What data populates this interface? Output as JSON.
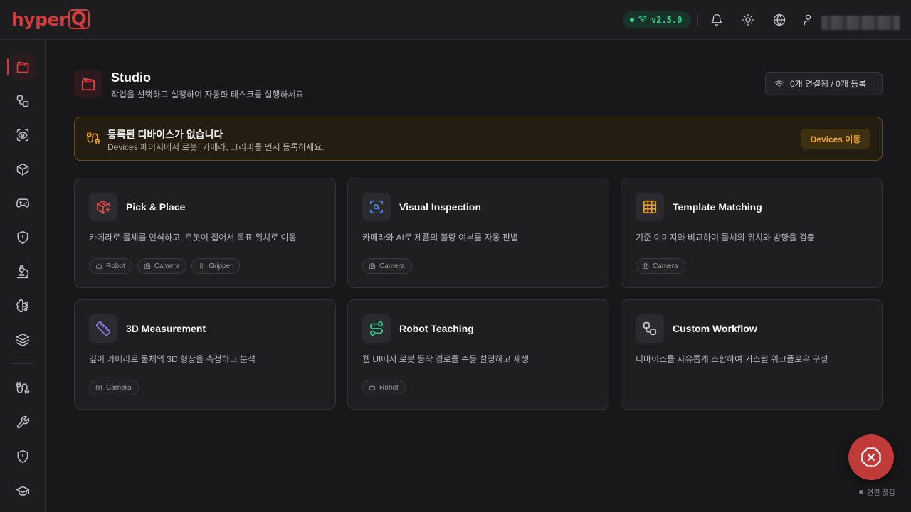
{
  "brand": {
    "name": "hyper",
    "suffix": "Q",
    "color": "#d63a3a"
  },
  "topbar": {
    "version": "v2.5.0",
    "icons": [
      "wifi-icon",
      "bell-icon",
      "sun-icon",
      "globe-icon",
      "user-icon"
    ]
  },
  "sidebar": {
    "items": [
      {
        "name": "studio",
        "icon": "clapperboard-icon",
        "active": true
      },
      {
        "name": "workflow",
        "icon": "workflow-icon"
      },
      {
        "name": "vision",
        "icon": "eye-scan-icon"
      },
      {
        "name": "3d",
        "icon": "cube-icon"
      },
      {
        "name": "control",
        "icon": "gamepad-icon"
      },
      {
        "name": "safety",
        "icon": "shield-alert-icon"
      },
      {
        "name": "lab",
        "icon": "microscope-icon"
      },
      {
        "name": "ai",
        "icon": "brain-icon"
      },
      {
        "name": "layers",
        "icon": "layers-icon"
      },
      {
        "name": "devices",
        "icon": "cable-icon"
      },
      {
        "name": "tools",
        "icon": "wrench-icon"
      },
      {
        "name": "security",
        "icon": "shield-icon"
      },
      {
        "name": "learn",
        "icon": "graduation-cap-icon"
      }
    ]
  },
  "header": {
    "title": "Studio",
    "subtitle": "작업을 선택하고 설정하여 자동화 태스크를 실행하세요",
    "connection_summary": "0개 연결됨 / 0개 등록"
  },
  "alert": {
    "title": "등록된 디바이스가 없습니다",
    "message": "Devices 페이지에서 로봇, 카메라, 그리퍼를 먼저 등록하세요.",
    "button": "Devices 이동",
    "color": "#f0a52a"
  },
  "cards": [
    {
      "title": "Pick & Place",
      "desc": "카메라로 물체를 인식하고, 로봇이 집어서 목표 위치로 이동",
      "icon": "package-plus-icon",
      "icon_color": "#e04848",
      "tags": [
        "Robot",
        "Camera",
        "Gripper"
      ]
    },
    {
      "title": "Visual Inspection",
      "desc": "카메라와 AI로 제품의 불량 여부를 자동 판별",
      "icon": "scan-search-icon",
      "icon_color": "#4a8cf0",
      "tags": [
        "Camera"
      ]
    },
    {
      "title": "Template Matching",
      "desc": "기준 이미지와 비교하여 물체의 위치와 방향을 검출",
      "icon": "grid-icon",
      "icon_color": "#f0a020",
      "tags": [
        "Camera"
      ]
    },
    {
      "title": "3D Measurement",
      "desc": "깊이 카메라로 물체의 3D 형상을 측정하고 분석",
      "icon": "ruler-icon",
      "icon_color": "#8a7cf0",
      "tags": [
        "Camera"
      ]
    },
    {
      "title": "Robot Teaching",
      "desc": "웹 UI에서 로봇 동작 경로를 수동 설정하고 재생",
      "icon": "route-icon",
      "icon_color": "#2fcf8a",
      "tags": [
        "Robot"
      ]
    },
    {
      "title": "Custom Workflow",
      "desc": "디바이스를 자유롭게 조합하여 커스텀 워크플로우 구성",
      "icon": "workflow-icon",
      "icon_color": "#c8c8ce",
      "tags": []
    }
  ],
  "fab": {
    "status": "연결 끊김"
  }
}
